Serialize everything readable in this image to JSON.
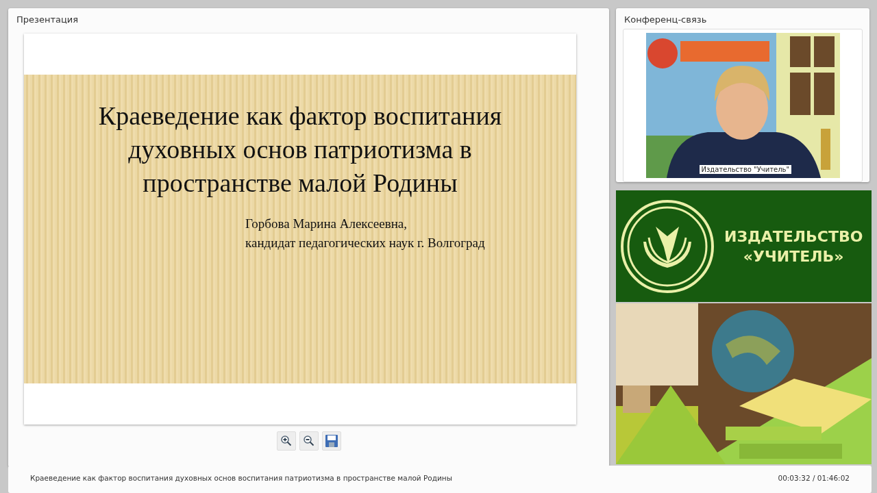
{
  "presentation": {
    "title": "Презентация",
    "slide": {
      "heading": "Краеведение как фактор воспитания духовных основ патриотизма в  пространстве малой Родины",
      "author": "Горбова Марина Алексеевна,",
      "position": "кандидат педагогических наук г. Волгоград"
    },
    "toolbar": [
      {
        "kind": "zoom-in"
      },
      {
        "kind": "zoom-out"
      },
      {
        "kind": "save"
      }
    ]
  },
  "conference": {
    "title": "Конференц-связь",
    "video": {
      "kind": "picture",
      "caption": "Издательство \"Учитель\""
    }
  },
  "banner": {
    "line1": "ИЗДАТЕЛЬСТВО",
    "line2": "«УЧИТЕЛЬ»"
  },
  "status_bar": {
    "title": "Краеведение как фактор воспитания духовных основ воспитания патриотизма в пространстве малой Родины",
    "time": "00:03:32 / 01:46:02"
  }
}
